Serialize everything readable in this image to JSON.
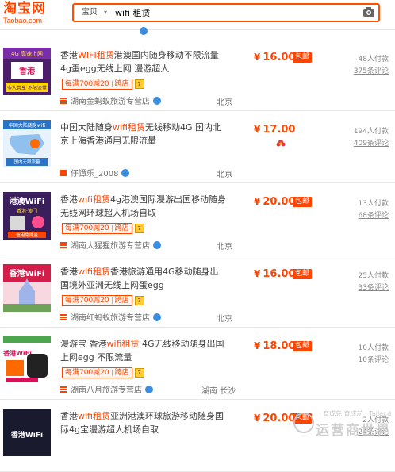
{
  "header": {
    "logo_text": "淘宝网",
    "logo_sub": "Taobao.com",
    "search_scope": "宝贝",
    "search_query": "wifi 租赁"
  },
  "colors": {
    "accent": "#ff4400",
    "shop_badge": "#3c8ee0",
    "border": "#e8e8e8"
  },
  "results": [
    {
      "title_parts": [
        "香港",
        "WIFI",
        "租赁",
        "港澳国内随身移动不限流量4g蛋egg无线上网 漫游超人"
      ],
      "promo_left": "每满700减20",
      "promo_right": "跨店",
      "shop": "湖南金蚂蚁旅游专营店",
      "location": "北京",
      "price": "16.00",
      "currency": "¥",
      "freeship": "包邮",
      "paid": "48人付款",
      "reviews": "375条评论",
      "thumb": {
        "text_top": "4G 高速上网",
        "text_mid": "香港",
        "text_bot": "多人共享 不限流量",
        "bg": "#5a1f7a"
      }
    },
    {
      "title_parts": [
        "中国大陆随身",
        "wifi",
        "租赁",
        "无线移动4G 国内北京上海香港通用无限流量"
      ],
      "promo_left": "",
      "promo_right": "",
      "shop": "仔谭乐_2008",
      "location": "北京",
      "price": "17.00",
      "currency": "¥",
      "freeship": "",
      "paid": "194人付款",
      "reviews": "409条评论",
      "thumb": {
        "text_top": "中国大陆随身wifi",
        "text_mid": "",
        "text_bot": "国内无限流量",
        "bg": "#2a74c8"
      }
    },
    {
      "title_parts": [
        "香港",
        "wifi",
        "租赁",
        "4g港澳国际漫游出国移动随身无线网环球超人机场自取"
      ],
      "promo_left": "每满700减20",
      "promo_right": "跨店",
      "shop": "湖南大猩猩旅游专营店",
      "location": "北京",
      "price": "20.00",
      "currency": "¥",
      "freeship": "包邮",
      "paid": "13人付款",
      "reviews": "68条评论",
      "thumb": {
        "text_top": "港澳WiFi",
        "text_mid": "香港·澳门",
        "text_bot": "信用免押金",
        "bg": "#3b1e5c"
      }
    },
    {
      "title_parts": [
        "香港",
        "wifi",
        "租赁",
        "香港旅游通用4G移动随身出国境外亚洲无线上网蛋egg"
      ],
      "promo_left": "每满700减20",
      "promo_right": "跨店",
      "shop": "湖南红蚂蚁旅游专营店",
      "location": "北京",
      "price": "16.00",
      "currency": "¥",
      "freeship": "包邮",
      "paid": "25人付款",
      "reviews": "33条评论",
      "thumb": {
        "text_top": "香港WiFi",
        "text_mid": "",
        "text_bot": "",
        "bg": "#d41e4a"
      }
    },
    {
      "title_parts": [
        "漫游宝 香港",
        "wifi",
        "租赁",
        " 4G无线移动随身出国上网egg 不限流量"
      ],
      "promo_left": "每满700减20",
      "promo_right": "跨店",
      "shop": "湖南八月旅游专营店",
      "location": "湖南 长沙",
      "price": "18.00",
      "currency": "¥",
      "freeship": "包邮",
      "paid": "10人付款",
      "reviews": "10条评论",
      "thumb": {
        "text_top": "香港WiFi",
        "text_mid": "",
        "text_bot": "",
        "bg": "#ffffff"
      }
    },
    {
      "title_parts": [
        "香港",
        "wifi",
        "租赁",
        "亚洲港澳环球旅游移动随身国际4g宝漫游超人机场自取"
      ],
      "promo_left": "",
      "promo_right": "",
      "shop": "",
      "location": "",
      "price": "20.00",
      "currency": "¥",
      "freeship": "包邮",
      "paid": "2人付款",
      "reviews": "24条评论",
      "thumb": {
        "text_top": "香港WiFi",
        "text_mid": "",
        "text_bot": "",
        "bg": "#1a1a2e"
      }
    }
  ],
  "watermark": {
    "line1": "· 育成先 育成前 · Tailer.d",
    "line2": "运营商世界"
  }
}
